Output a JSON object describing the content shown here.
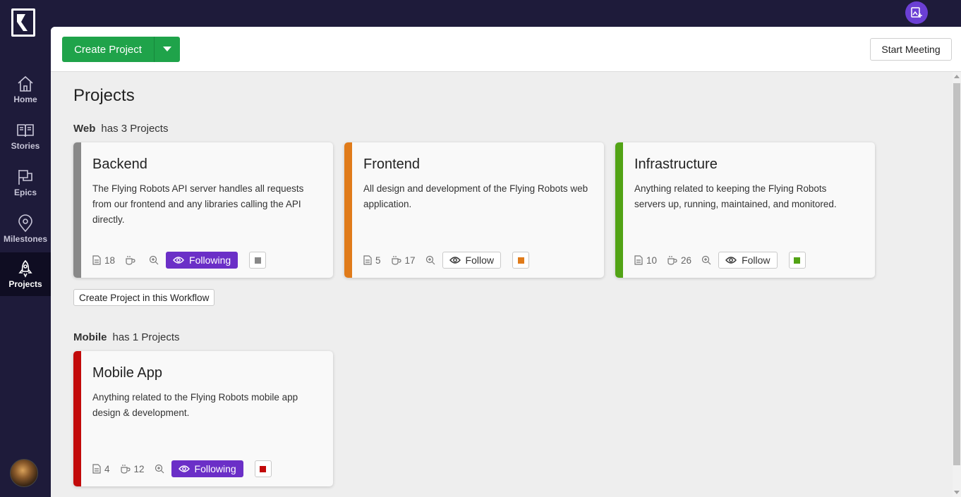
{
  "sidebar": {
    "items": [
      {
        "label": "Home",
        "icon": "home-icon"
      },
      {
        "label": "Stories",
        "icon": "book-icon"
      },
      {
        "label": "Epics",
        "icon": "flag-icon"
      },
      {
        "label": "Milestones",
        "icon": "map-pin-icon"
      },
      {
        "label": "Projects",
        "icon": "rocket-icon",
        "active": true
      }
    ]
  },
  "toolbar": {
    "create_label": "Create Project",
    "meeting_label": "Start Meeting"
  },
  "page": {
    "title": "Projects"
  },
  "groups": [
    {
      "name": "Web",
      "suffix": "has 3 Projects",
      "create_in_workflow": "Create Project in this Workflow",
      "projects": [
        {
          "title": "Backend",
          "description": "The Flying Robots API server handles all requests from our frontend and any libraries calling the API directly.",
          "stories": "18",
          "points": "",
          "follow": "Following",
          "following": true,
          "color": "#888888"
        },
        {
          "title": "Frontend",
          "description": "All design and development of the Flying Robots web application.",
          "stories": "5",
          "points": "17",
          "follow": "Follow",
          "following": false,
          "color": "#e07b1a"
        },
        {
          "title": "Infrastructure",
          "description": "Anything related to keeping the Flying Robots servers up, running, maintained, and monitored.",
          "stories": "10",
          "points": "26",
          "follow": "Follow",
          "following": false,
          "color": "#52a315"
        }
      ]
    },
    {
      "name": "Mobile",
      "suffix": "has 1 Projects",
      "projects": [
        {
          "title": "Mobile App",
          "description": "Anything related to the Flying Robots mobile app design & development.",
          "stories": "4",
          "points": "12",
          "follow": "Following",
          "following": true,
          "color": "#c20a0a"
        }
      ]
    }
  ],
  "colors": {
    "accent_green": "#1fa34a",
    "accent_purple": "#6b2fc7",
    "sidebar_bg": "#1e1b3a"
  }
}
